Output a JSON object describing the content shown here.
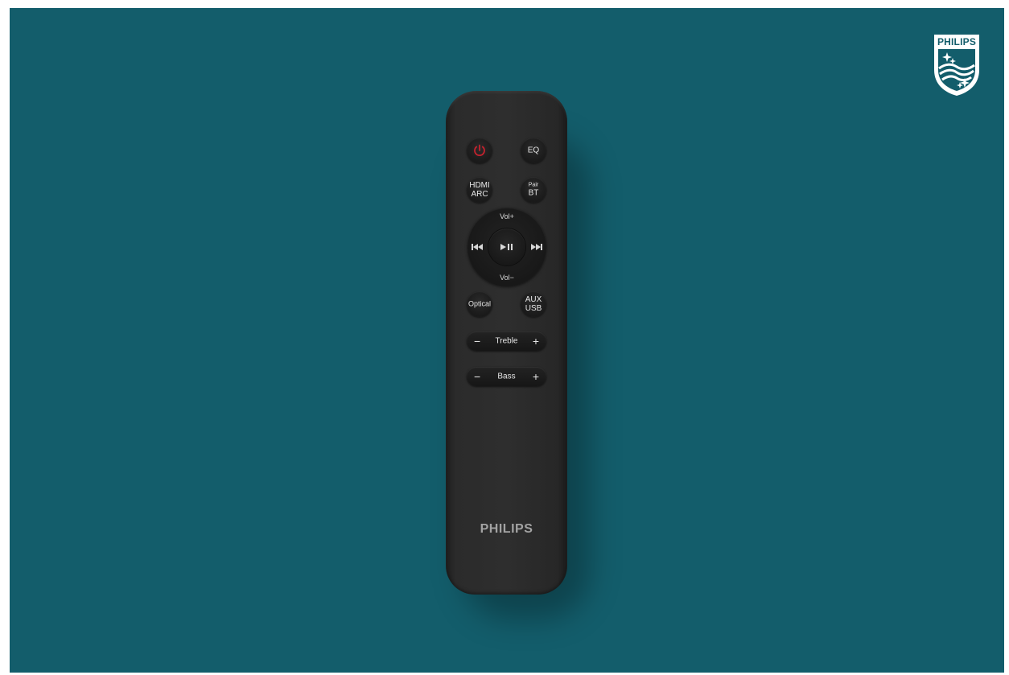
{
  "logo": {
    "wordmark": "PHILIPS",
    "colors": {
      "brand": "#ffffff"
    }
  },
  "remote": {
    "buttons": {
      "power_icon": "power-icon",
      "eq": "EQ",
      "hdmi_line1": "HDMI",
      "hdmi_line2": "ARC",
      "pair_line1": "Pair",
      "pair_line2": "BT",
      "optical": "Optical",
      "aux_line1": "AUX",
      "aux_line2": "USB"
    },
    "dpad": {
      "vol_up": "Vol+",
      "vol_down": "Vol−",
      "prev_icon": "previous-track-icon",
      "next_icon": "next-track-icon",
      "play_icon": "play-pause-icon"
    },
    "treble": {
      "label": "Treble",
      "minus": "−",
      "plus": "+"
    },
    "bass": {
      "label": "Bass",
      "minus": "−",
      "plus": "+"
    },
    "brand": "PHILIPS"
  },
  "colors": {
    "background": "#135d6b",
    "power_accent": "#c4222e",
    "remote_body": "#2b2b2b"
  }
}
